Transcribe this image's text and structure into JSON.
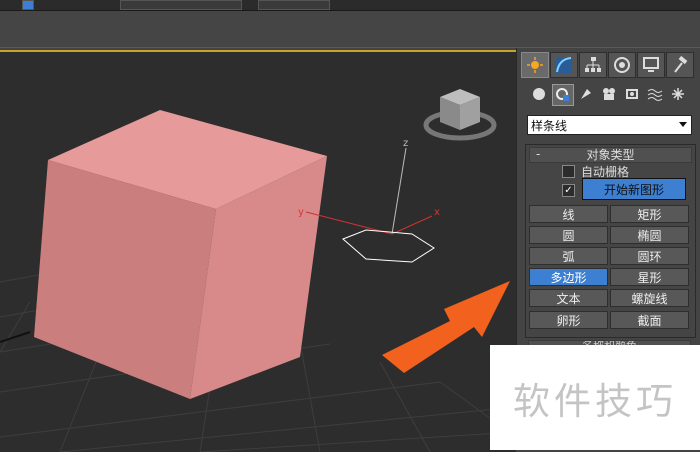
{
  "command_panel": {
    "tabs": [
      {
        "name": "create-tab",
        "icon": "sun-icon",
        "active": true
      },
      {
        "name": "modify-tab",
        "icon": "curve-icon"
      },
      {
        "name": "hierarchy-tab",
        "icon": "hierarchy-icon"
      },
      {
        "name": "motion-tab",
        "icon": "motion-icon"
      },
      {
        "name": "display-tab",
        "icon": "monitor-icon"
      },
      {
        "name": "utilities-tab",
        "icon": "hammer-icon"
      }
    ],
    "subcategories": [
      {
        "name": "geometry",
        "icon": "sphere-icon"
      },
      {
        "name": "shapes",
        "icon": "shapes-icon",
        "active": true
      },
      {
        "name": "lights",
        "icon": "light-icon"
      },
      {
        "name": "cameras",
        "icon": "camera-icon"
      },
      {
        "name": "helpers",
        "icon": "helper-icon"
      },
      {
        "name": "space-warps",
        "icon": "wave-icon"
      },
      {
        "name": "systems",
        "icon": "systems-icon"
      }
    ],
    "category_dropdown": "样条线",
    "object_type": {
      "title": "对象类型",
      "collapse_symbol": "-",
      "auto_grid_label": "自动栅格",
      "start_new_shape_label": "开始新图形",
      "start_new_shape_checked": "✓",
      "buttons": [
        "线",
        "矩形",
        "圆",
        "椭圆",
        "弧",
        "圆环",
        "多边形",
        "星形",
        "文本",
        "螺旋线",
        "卵形",
        "截面"
      ],
      "active_button": "多边形"
    },
    "name_and_color_title": "名称和颜色"
  },
  "viewport": {
    "axis_z": "z",
    "axis_x": "x",
    "axis_y": "y"
  },
  "watermark": "软件技巧",
  "colors": {
    "accent_blue": "#3d7fd1",
    "box_front": "#cb7e7e",
    "box_top": "#e69a9a",
    "arrow": "#f2621e",
    "viewport_border": "#c9a227"
  }
}
